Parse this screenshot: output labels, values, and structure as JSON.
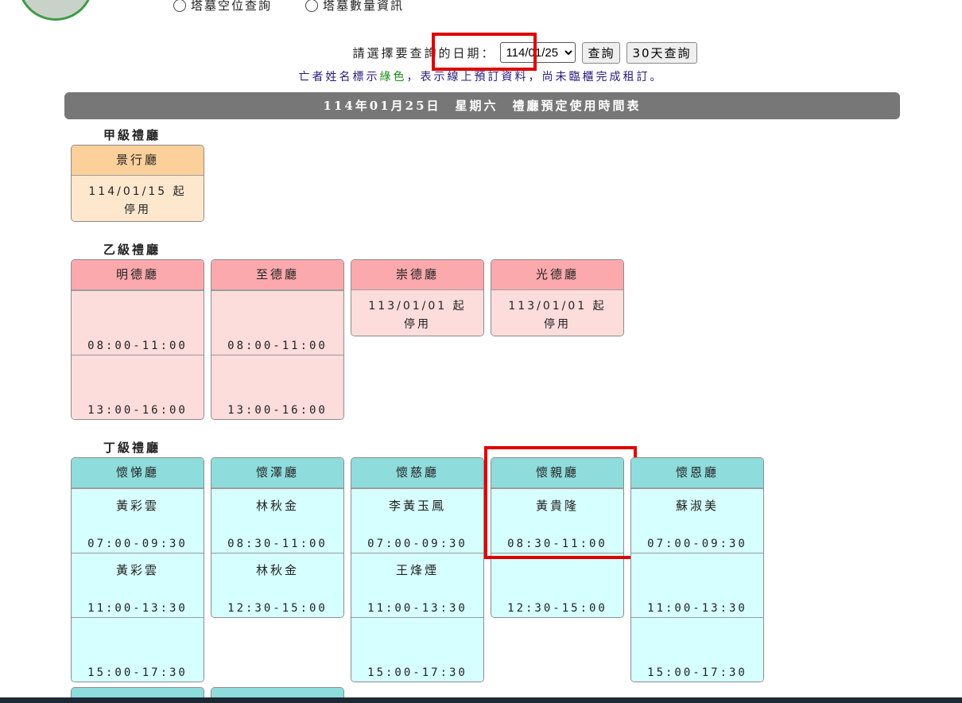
{
  "nav": {
    "radio1": "塔墓空位查詢",
    "radio2": "塔墓數量資訊"
  },
  "query": {
    "label": "請選擇要查詢的日期：",
    "date_value": "114/01/25",
    "query_button": "查詢",
    "thirty_button": "30天查詢"
  },
  "note": {
    "part1": "亡者姓名標示",
    "green_word": "綠色",
    "part2": "，表示線上預訂資料，尚未臨櫃完成租訂。"
  },
  "schedule_title": "114年01月25日　星期六　禮廳預定使用時間表",
  "colors": {
    "highlight": "#e00000",
    "grade_a_head": "#fbd09b",
    "grade_b_head": "#fba9ad",
    "grade_d_head": "#8fdcdc",
    "online_name": "#1a8a1a"
  },
  "sections": {
    "a": {
      "label": "甲級禮廳",
      "halls": [
        {
          "name": "景行廳",
          "closed_line1": "114/01/15 起",
          "closed_line2": "停用"
        }
      ]
    },
    "b": {
      "label": "乙級禮廳",
      "halls": [
        {
          "name": "明德廳",
          "slots": [
            {
              "who": "",
              "time": "08:00-11:00"
            },
            {
              "who": "",
              "time": "13:00-16:00"
            }
          ]
        },
        {
          "name": "至德廳",
          "slots": [
            {
              "who": "",
              "time": "08:00-11:00"
            },
            {
              "who": "",
              "time": "13:00-16:00"
            }
          ]
        },
        {
          "name": "崇德廳",
          "closed_line1": "113/01/01 起",
          "closed_line2": "停用"
        },
        {
          "name": "光德廳",
          "closed_line1": "113/01/01 起",
          "closed_line2": "停用"
        }
      ]
    },
    "d": {
      "label": "丁級禮廳",
      "halls": [
        {
          "name": "懷悌廳",
          "slots": [
            {
              "who": "黃彩雲",
              "time": "07:00-09:30"
            },
            {
              "who": "黃彩雲",
              "time": "11:00-13:30"
            },
            {
              "who": "",
              "time": "15:00-17:30"
            }
          ]
        },
        {
          "name": "懷澤廳",
          "slots": [
            {
              "who": "林秋金",
              "time": "08:30-11:00"
            },
            {
              "who": "林秋金",
              "time": "12:30-15:00"
            }
          ]
        },
        {
          "name": "懷慈廳",
          "slots": [
            {
              "who": "李黃玉鳳",
              "time": "07:00-09:30"
            },
            {
              "who": "王烽煙",
              "time": "11:00-13:30"
            },
            {
              "who": "",
              "time": "15:00-17:30"
            }
          ]
        },
        {
          "name": "懷親廳",
          "slots": [
            {
              "who": "黃貴隆",
              "time": "08:30-11:00"
            },
            {
              "who": "",
              "time": "12:30-15:00"
            }
          ]
        },
        {
          "name": "懷恩廳",
          "slots": [
            {
              "who": "蘇淑美",
              "time": "07:00-09:30"
            },
            {
              "who": "",
              "time": "11:00-13:30"
            },
            {
              "who": "",
              "time": "15:00-17:30"
            }
          ]
        }
      ]
    }
  }
}
